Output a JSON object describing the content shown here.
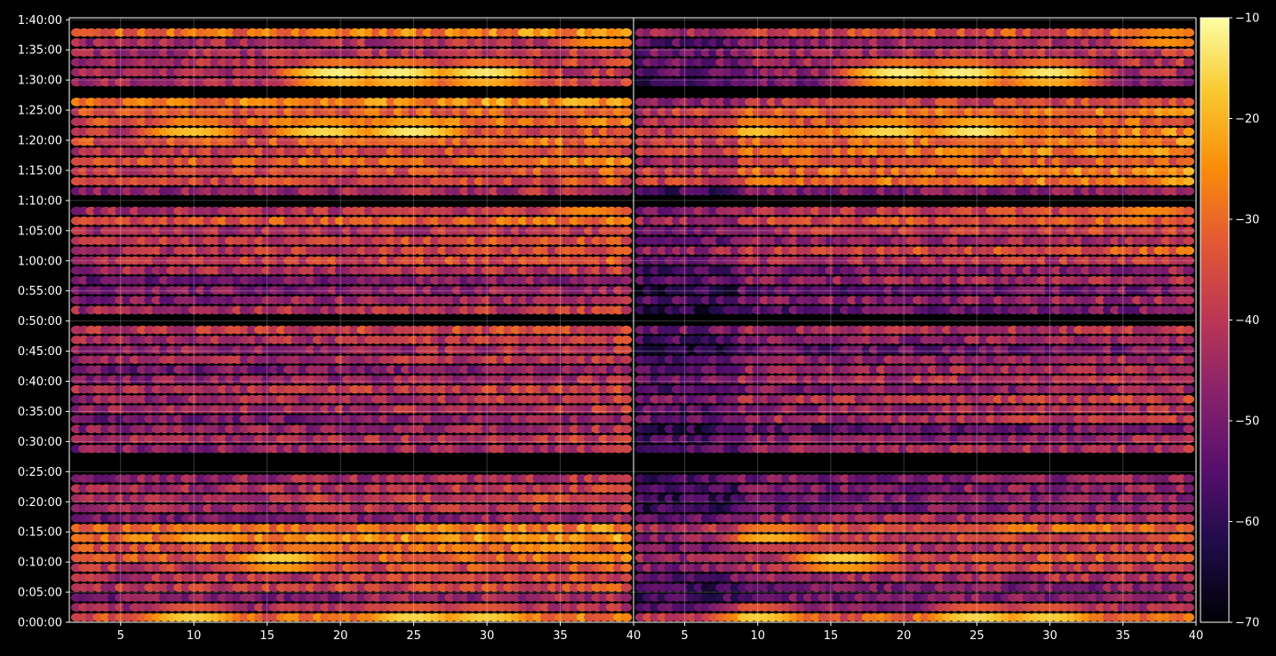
{
  "chart_data": {
    "type": "heatmap",
    "title": "",
    "xlabel": "",
    "ylabel": "",
    "colormap": "inferno",
    "background": "#000000",
    "grid": true,
    "panels": [
      {
        "name": "",
        "xlim": [
          1.5,
          40
        ],
        "xticks": [
          5,
          10,
          15,
          20,
          25,
          30,
          35,
          40
        ],
        "xtick_labels": [
          "5",
          "10",
          "15",
          "20",
          "25",
          "30",
          "35",
          "40"
        ]
      },
      {
        "name": "",
        "xlim": [
          1.5,
          40
        ],
        "xticks": [
          5,
          10,
          15,
          20,
          25,
          30,
          35,
          40
        ],
        "xtick_labels": [
          "5",
          "10",
          "15",
          "20",
          "25",
          "30",
          "35",
          "40"
        ]
      }
    ],
    "ylim_seconds": [
      0,
      6020
    ],
    "yticks_seconds": [
      0,
      300,
      600,
      900,
      1200,
      1500,
      1800,
      2100,
      2400,
      2700,
      3000,
      3300,
      3600,
      3900,
      4200,
      4500,
      4800,
      5100,
      5400,
      5700,
      6000
    ],
    "ytick_labels": [
      "0:00:00",
      "0:05:00",
      "0:10:00",
      "0:15:00",
      "0:20:00",
      "0:25:00",
      "0:30:00",
      "0:35:00",
      "0:40:00",
      "0:45:00",
      "0:50:00",
      "0:55:00",
      "1:00:00",
      "1:05:00",
      "1:10:00",
      "1:15:00",
      "1:20:00",
      "1:25:00",
      "1:30:00",
      "1:35:00",
      "1:40:00"
    ],
    "colorbar": {
      "range": [
        -70,
        -10
      ],
      "ticks": [
        -70,
        -60,
        -50,
        -40,
        -30,
        -20,
        -10
      ],
      "tick_labels": [
        "−70",
        "−60",
        "−50",
        "−40",
        "−30",
        "−20",
        "−10"
      ]
    },
    "bins": {
      "x_start": 2,
      "x_end": 39,
      "rows": 61
    },
    "row_gaps_seconds": [
      [
        1500,
        1640
      ],
      [
        2950,
        3050
      ],
      [
        4100,
        4230
      ],
      [
        5250,
        5350
      ],
      [
        5960,
        6020
      ]
    ],
    "intensity_bands": [
      {
        "time_range_seconds": [
          0,
          120
        ],
        "level_dB": -30
      },
      {
        "time_range_seconds": [
          120,
          480
        ],
        "level_dB": -42
      },
      {
        "time_range_seconds": [
          480,
          1000
        ],
        "level_dB": -32
      },
      {
        "time_range_seconds": [
          1000,
          1480
        ],
        "level_dB": -42
      },
      {
        "time_range_seconds": [
          1480,
          1650
        ],
        "level_dB": -60
      },
      {
        "time_range_seconds": [
          1650,
          2100
        ],
        "level_dB": -45
      },
      {
        "time_range_seconds": [
          2100,
          2450
        ],
        "level_dB": -40
      },
      {
        "time_range_seconds": [
          2450,
          2950
        ],
        "level_dB": -44
      },
      {
        "time_range_seconds": [
          2950,
          3050
        ],
        "level_dB": -60
      },
      {
        "time_range_seconds": [
          3050,
          3600
        ],
        "level_dB": -45
      },
      {
        "time_range_seconds": [
          3600,
          4100
        ],
        "level_dB": -38
      },
      {
        "time_range_seconds": [
          4100,
          4300
        ],
        "level_dB": -50
      },
      {
        "time_range_seconds": [
          4300,
          4900
        ],
        "level_dB": -32
      },
      {
        "time_range_seconds": [
          4900,
          5250
        ],
        "level_dB": -30
      },
      {
        "time_range_seconds": [
          5250,
          5350
        ],
        "level_dB": -60
      },
      {
        "time_range_seconds": [
          5350,
          5850
        ],
        "level_dB": -40
      },
      {
        "time_range_seconds": [
          5850,
          6000
        ],
        "level_dB": -34
      }
    ],
    "hotspots": [
      {
        "x": 10,
        "time_seconds": 4900,
        "level_dB": -18
      },
      {
        "x": 19,
        "time_seconds": 4900,
        "level_dB": -15
      },
      {
        "x": 25,
        "time_seconds": 4900,
        "level_dB": -13
      },
      {
        "x": 20,
        "time_seconds": 5460,
        "level_dB": -12
      },
      {
        "x": 24,
        "time_seconds": 5460,
        "level_dB": -12
      },
      {
        "x": 30,
        "time_seconds": 5460,
        "level_dB": -13
      },
      {
        "x": 16,
        "time_seconds": 620,
        "level_dB": -16
      },
      {
        "x": 11,
        "time_seconds": 860,
        "level_dB": -20
      },
      {
        "x": 10,
        "time_seconds": 30,
        "level_dB": -16
      },
      {
        "x": 25,
        "time_seconds": 30,
        "level_dB": -15
      },
      {
        "x": 30,
        "time_seconds": 30,
        "level_dB": -16
      },
      {
        "x": 38,
        "time_seconds": 5820,
        "level_dB": -22
      },
      {
        "x": 37,
        "time_seconds": 4150,
        "level_dB": -22
      }
    ]
  }
}
